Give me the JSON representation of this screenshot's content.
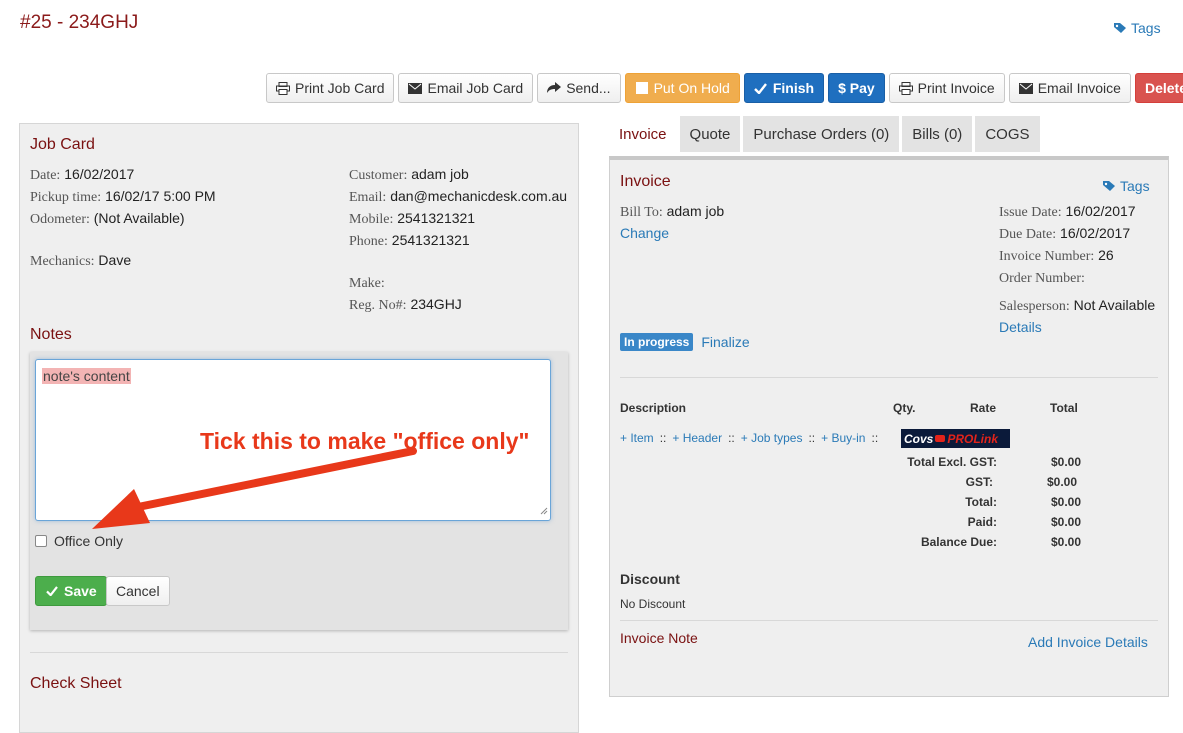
{
  "header": {
    "title": "#25 - 234GHJ",
    "tags_label": "Tags"
  },
  "toolbar": {
    "print_job_card": "Print Job Card",
    "email_job_card": "Email Job Card",
    "send": "Send...",
    "put_on_hold": "Put On Hold",
    "finish": "Finish",
    "pay": "$ Pay",
    "print_invoice": "Print Invoice",
    "email_invoice": "Email Invoice",
    "delete": "Delete"
  },
  "job_card": {
    "title": "Job Card",
    "date_label": "Date:",
    "date_value": "16/02/2017",
    "pickup_label": "Pickup time:",
    "pickup_value": "16/02/17 5:00 PM",
    "odometer_label": "Odometer:",
    "odometer_value": "(Not Available)",
    "mechanics_label": "Mechanics:",
    "mechanics_value": "Dave",
    "customer_label": "Customer:",
    "customer_value": "adam job",
    "email_label": "Email:",
    "email_value": "dan@mechanicdesk.com.au",
    "mobile_label": "Mobile:",
    "mobile_value": "2541321321",
    "phone_label": "Phone:",
    "phone_value": "2541321321",
    "make_label": "Make:",
    "make_value": "",
    "rego_label": "Reg. No#:",
    "rego_value": "234GHJ"
  },
  "notes": {
    "title": "Notes",
    "content": "note's content",
    "office_only_label": "Office Only",
    "office_only_checked": false,
    "save_label": "Save",
    "cancel_label": "Cancel",
    "callout": "Tick this to make \"office only\""
  },
  "check_sheet": {
    "title": "Check Sheet"
  },
  "tabs": [
    {
      "label": "Invoice",
      "active": true
    },
    {
      "label": "Quote",
      "active": false
    },
    {
      "label": "Purchase Orders (0)",
      "active": false
    },
    {
      "label": "Bills (0)",
      "active": false
    },
    {
      "label": "COGS",
      "active": false
    }
  ],
  "invoice": {
    "title": "Invoice",
    "tags_label": "Tags",
    "bill_to_label": "Bill To:",
    "bill_to_value": "adam job",
    "change_label": "Change",
    "issue_date_label": "Issue Date:",
    "issue_date_value": "16/02/2017",
    "due_date_label": "Due Date:",
    "due_date_value": "16/02/2017",
    "invoice_number_label": "Invoice Number:",
    "invoice_number_value": "26",
    "order_number_label": "Order Number:",
    "order_number_value": "",
    "salesperson_label": "Salesperson:",
    "salesperson_value": "Not Available",
    "details_label": "Details",
    "status_badge": "In progress",
    "finalize_label": "Finalize",
    "col_description": "Description",
    "col_qty": "Qty.",
    "col_rate": "Rate",
    "col_total": "Total",
    "add_item": "+ Item",
    "add_header": "+ Header",
    "add_job_types": "+ Job types",
    "add_buy_in": "+ Buy-in",
    "sep": "::",
    "logo_text_a": "Covs",
    "logo_text_b": "PROLink",
    "totals": [
      {
        "label": "Total Excl. GST:",
        "value": "$0.00"
      },
      {
        "label": "GST:",
        "value": "$0.00"
      },
      {
        "label": "Total:",
        "value": "$0.00"
      },
      {
        "label": "Paid:",
        "value": "$0.00"
      },
      {
        "label": "Balance Due:",
        "value": "$0.00"
      }
    ],
    "discount_title": "Discount",
    "discount_value": "No Discount",
    "invoice_note_label": "Invoice Note",
    "add_invoice_details": "Add Invoice Details"
  },
  "colors": {
    "title_maroon": "#8b1a1a",
    "link_blue": "#2a7ab7",
    "warning": "#f0ad4e",
    "primary": "#1f6fbf",
    "danger": "#d9534f",
    "success": "#4cae4c",
    "callout_red": "#e8381a"
  }
}
